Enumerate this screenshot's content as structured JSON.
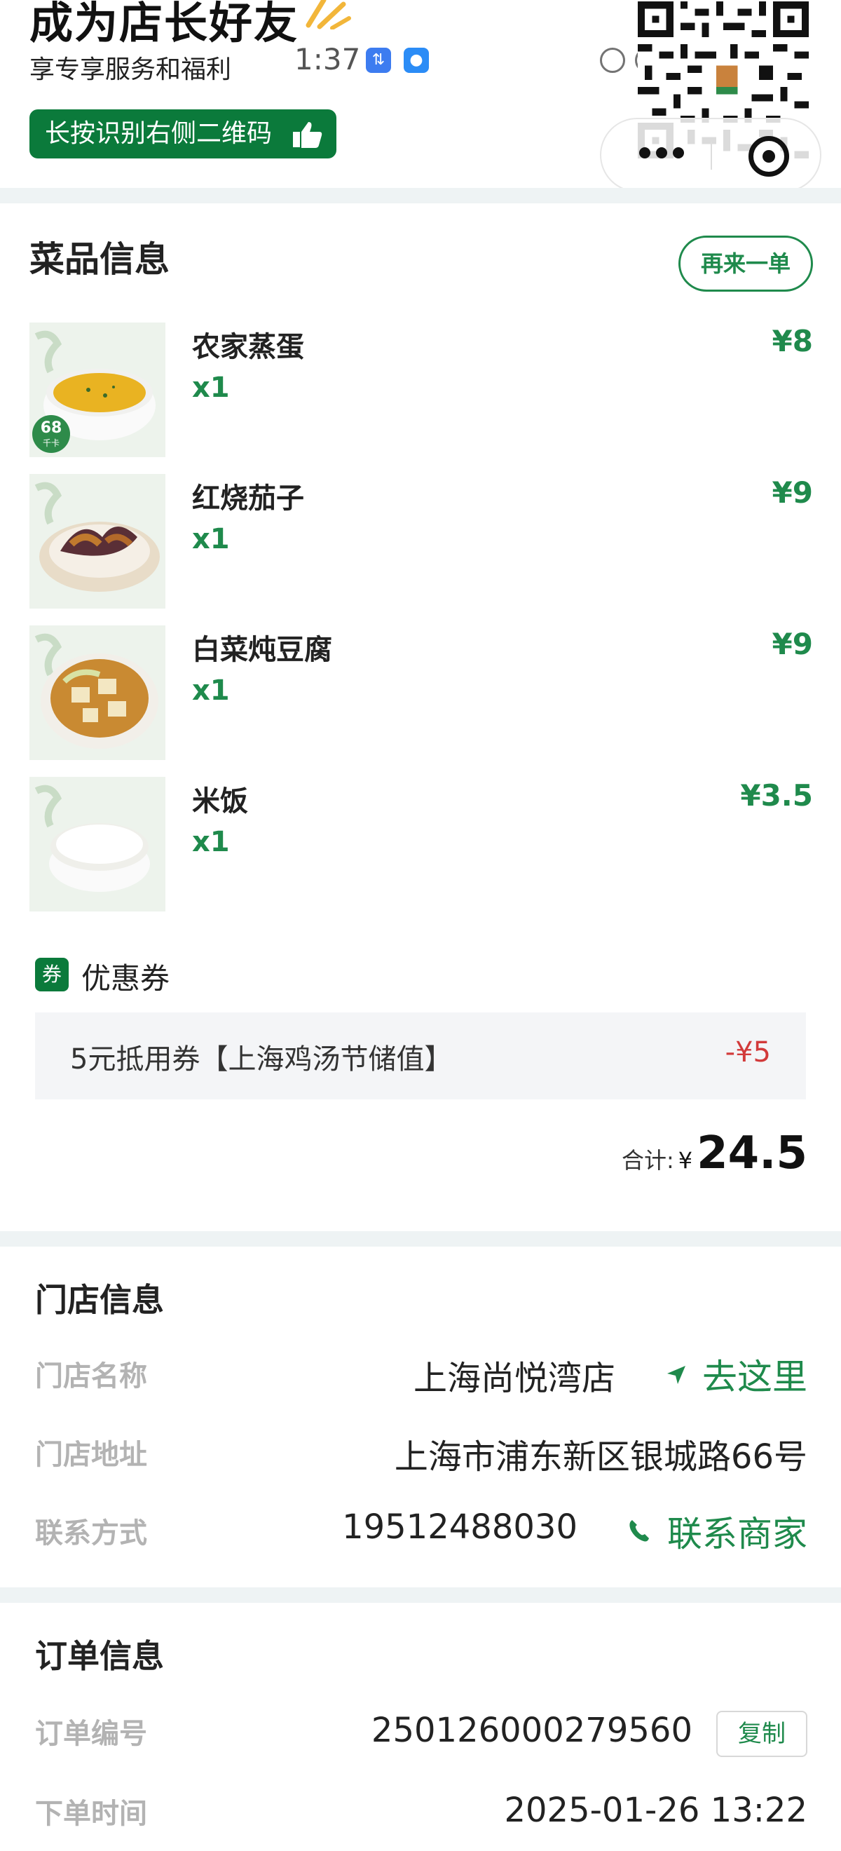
{
  "banner": {
    "title": "成为店长好友",
    "subtitle": "享专享服务和福利",
    "time": "1:37",
    "cta_label": "长按识别右侧二维码"
  },
  "dishes": {
    "title": "菜品信息",
    "reorder_label": "再来一单",
    "items": [
      {
        "name": "农家蒸蛋",
        "qty": "x1",
        "price": "¥8",
        "kcal": "68",
        "kcal_unit": "千卡"
      },
      {
        "name": "红烧茄子",
        "qty": "x1",
        "price": "¥9"
      },
      {
        "name": "白菜炖豆腐",
        "qty": "x1",
        "price": "¥9"
      },
      {
        "name": "米饭",
        "qty": "x1",
        "price": "¥3.5"
      }
    ]
  },
  "coupon": {
    "tag": "券",
    "title": "优惠券",
    "name": "5元抵用券【上海鸡汤节储值】",
    "amount": "-¥5"
  },
  "total": {
    "label": "合计:",
    "currency": "¥",
    "value": "24.5"
  },
  "store": {
    "title": "门店信息",
    "name_label": "门店名称",
    "name": "上海尚悦湾店",
    "nav_label": "去这里",
    "address_label": "门店地址",
    "address": "上海市浦东新区银城路66号",
    "contact_label": "联系方式",
    "phone": "19512488030",
    "contact_action": "联系商家"
  },
  "order": {
    "title": "订单信息",
    "number_label": "订单编号",
    "number": "250126000279560",
    "copy_label": "复制",
    "time_label": "下单时间",
    "time": "2025-01-26 13:22"
  },
  "colors": {
    "brand_green": "#0b7a3b",
    "accent_green": "#1f8a4c",
    "discount_red": "#d23a3a",
    "divider": "#eef3f4"
  }
}
